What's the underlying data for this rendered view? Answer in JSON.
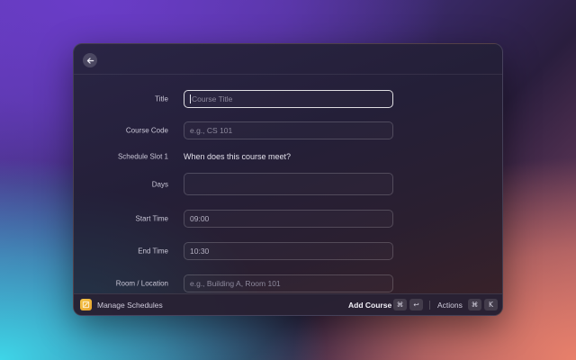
{
  "app": {
    "name": "Manage Schedules"
  },
  "form": {
    "title": {
      "label": "Title",
      "placeholder": "Course Title"
    },
    "course_code": {
      "label": "Course Code",
      "placeholder": "e.g., CS 101"
    },
    "schedule_slot": {
      "label": "Schedule Slot 1",
      "text": "When does this course meet?"
    },
    "days": {
      "label": "Days",
      "value": ""
    },
    "start_time": {
      "label": "Start Time",
      "value": "09:00"
    },
    "end_time": {
      "label": "End Time",
      "value": "10:30"
    },
    "room": {
      "label": "Room / Location",
      "placeholder": "e.g., Building A, Room 101"
    }
  },
  "footer": {
    "primary_action": "Add Course",
    "primary_keys": [
      "⌘",
      "↩"
    ],
    "actions_label": "Actions",
    "actions_keys": [
      "⌘",
      "K"
    ]
  },
  "icons": {
    "back": "arrow-left-icon",
    "app": "notepad-icon"
  },
  "colors": {
    "app_icon": "#f6c64a",
    "focus_border": "#ffffff"
  }
}
